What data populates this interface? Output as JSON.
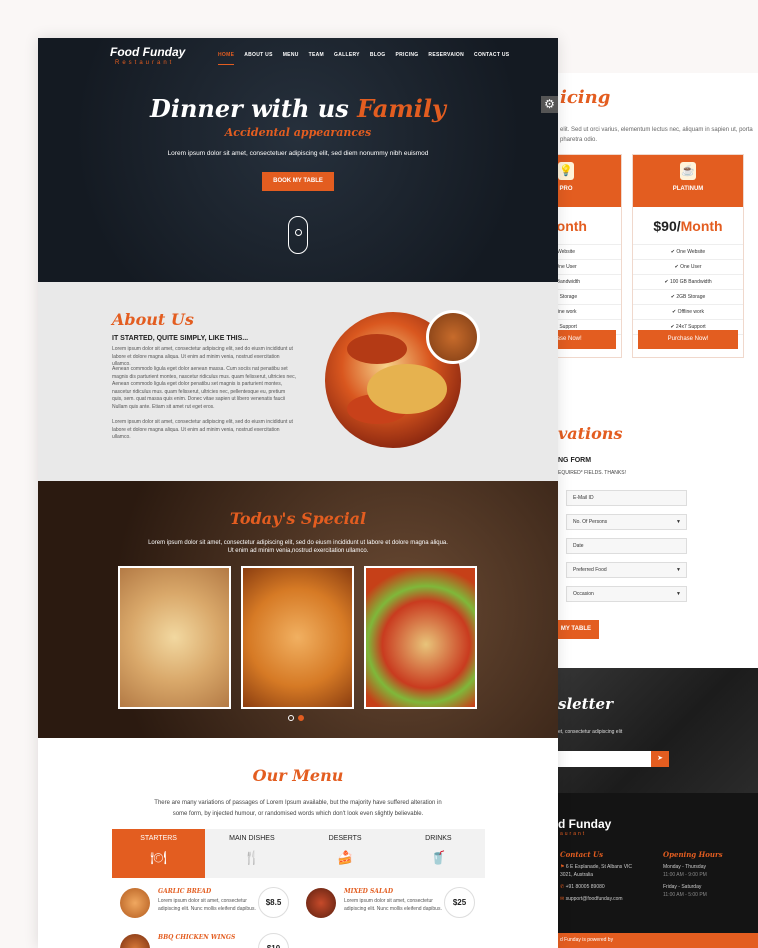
{
  "back": {
    "pricing_title": "Pricing",
    "pricing_title_visible": "icing",
    "pricing_desc": "elit. Sed ut orci varius, elementum lectus nec, aliquam in sapien ut, porta pharetra odio.",
    "plans": [
      {
        "name": "PRO",
        "price": "Month",
        "features": [
          "Website",
          "One User",
          "B Bandwidth",
          "B Storage",
          "fline work",
          "7 Support"
        ],
        "button": "chase Now!"
      },
      {
        "name": "PLATINUM",
        "price_amount": "$90/",
        "price_unit": "Month",
        "features": [
          "One Website",
          "One User",
          "100 GB Bandwidth",
          "2GB Storage",
          "Offline work",
          "24x7 Support"
        ],
        "button": "Purchase Now!"
      }
    ],
    "reservations_title": "vations",
    "reservation_form_title": "NG FORM",
    "reservation_note": "EQUIRED* FIELDS. THANKS!",
    "fields": [
      {
        "label": "E-Mail ID",
        "dropdown": false
      },
      {
        "label": "No. Of Persons",
        "dropdown": true
      },
      {
        "label": "Date",
        "dropdown": false
      },
      {
        "label": "Preferred Food",
        "dropdown": true
      },
      {
        "label": "Occasion",
        "dropdown": true
      }
    ],
    "reservation_button": "MY TABLE",
    "newsletter_title": "sletter",
    "newsletter_desc": "et, consectetur adipiscing elit",
    "newsletter_send_icon": "paper-plane-icon",
    "footer_logo": "d Funday",
    "footer_logo_sub": "aurant",
    "contact_heading": "Contact Us",
    "contact_address": "6 E Esplanade, St Albans VIC 3021, Australia",
    "contact_phone": "+91 80005 89080",
    "contact_email": "support@foodfunday.com",
    "hours_heading": "Opening Hours",
    "hours": [
      {
        "days": "Monday - Thursday",
        "time": "11:00 AM - 9:00 PM"
      },
      {
        "days": "Friday - Saturday",
        "time": "11:00 AM - 5:00 PM"
      }
    ],
    "copyright": "d Funday is powered by"
  },
  "front": {
    "logo": "Food Funday",
    "logo_sub": "Restaurant",
    "nav": [
      "HOME",
      "ABOUT US",
      "MENU",
      "TEAM",
      "GALLERY",
      "BLOG",
      "PRICING",
      "RESERVAION",
      "CONTACT US"
    ],
    "hero_title_a": "Dinner with us ",
    "hero_title_b": "Family",
    "hero_subtitle": "Accidental appearances",
    "hero_text": "Lorem ipsum dolor sit amet, consectetuer adipiscing elit, sed diem nonummy nibh euismod",
    "hero_button": "BOOK MY TABLE",
    "about_title": "About Us",
    "about_subtitle": "IT STARTED, QUITE SIMPLY, LIKE THIS...",
    "about_p1": "Lorem ipsum dolor sit amet, consectetur adipiscing elit, sed do eiusm incididunt ut labore et dolore magna aliqua. Ut enim ad minim venia, nostrud exercitation ullamco.",
    "about_p2": "Aenean commodo ligula eget dolor aenean massa. Cum sociis nat penatibu set magnis dis parturient montes, nascetur ridiculus mus. quam felisserut, ultricies nec, Aenean commodo ligula eget dolor penatibu set magnis is parturient montes, nascetur ridiculus mus. quam felisserut, ultricies nec, pellentesque eu, pretium quis, sem. quat massa quis enim. Donec vitae sapien ut libero venenatis faucii Nullam quis ante. Etiam sit amet rut eget eros.",
    "about_p3": "Lorem ipsum dolor sit amet, consectetur adipiscing elit, sed do eiusm incididunt ut labore et dolore magna aliqua. Ut enim ad minim venia, nostrud exercitation ullamco.",
    "special_title": "Today's Special",
    "special_desc": "Lorem ipsum dolor sit amet, consectetur adipiscing elit, sed do eiusm incididunt ut labore et dolore magna aliqua. Ut enim ad minim venia,nostrud exercitation ullamco.",
    "menu_title": "Our Menu",
    "menu_desc": "There are many variations of passages of Lorem Ipsum available, but the majority have suffered alteration in some form, by injected humour, or randomised words which don't look even slightly believable.",
    "tabs": [
      {
        "label": "STARTERS",
        "icon": "plate-icon"
      },
      {
        "label": "MAIN DISHES",
        "icon": "dish-icon"
      },
      {
        "label": "DESERTS",
        "icon": "cake-icon"
      },
      {
        "label": "DRINKS",
        "icon": "cup-icon"
      }
    ],
    "menu_items": [
      {
        "name": "GARLIC BREAD",
        "desc": "Lorem ipsum dolor sit amet, consectetur adipiscing elit. Nunc mollis eleifend dapibus.",
        "price": "$8.5"
      },
      {
        "name": "MIXED SALAD",
        "desc": "Lorem ipsum dolor sit amet, consectetur adipiscing elit. Nunc mollis eleifend dapibus.",
        "price": "$25"
      },
      {
        "name": "BBQ CHICKEN WINGS",
        "desc": "",
        "price": "$10"
      }
    ]
  },
  "colors": {
    "accent": "#e35d20",
    "dark": "#141a22"
  }
}
